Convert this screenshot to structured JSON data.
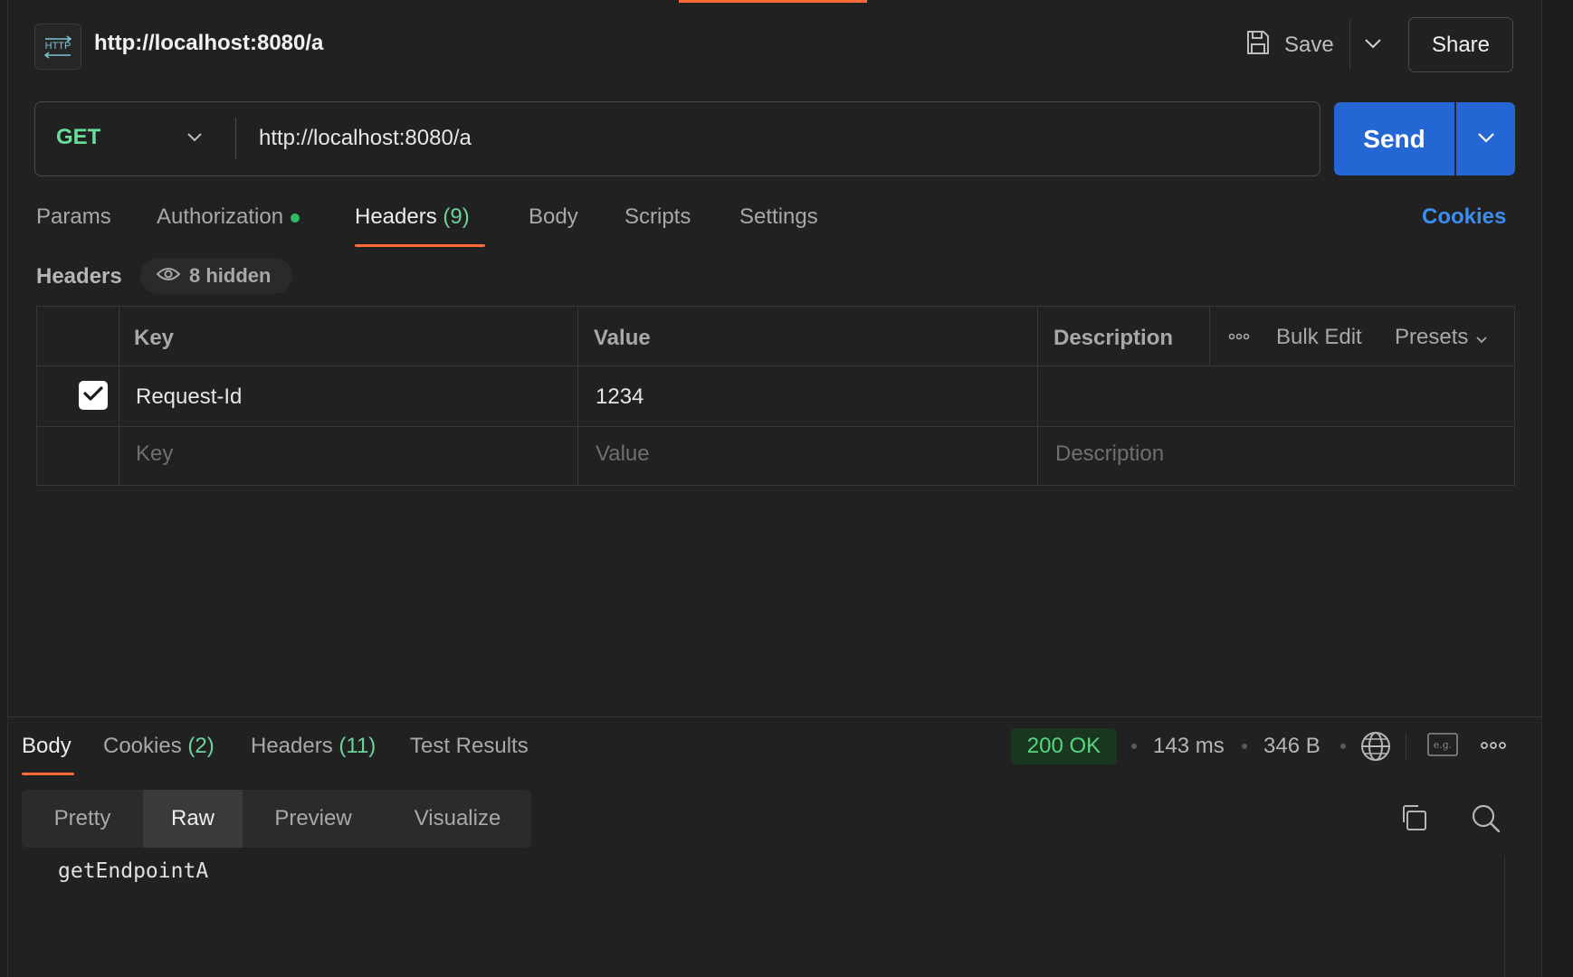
{
  "window": {
    "title": "http://localhost:8080/a"
  },
  "toolbar": {
    "save_label": "Save",
    "share_label": "Share"
  },
  "request": {
    "method": "GET",
    "url": "http://localhost:8080/a",
    "send_label": "Send"
  },
  "request_tabs": {
    "params": "Params",
    "authorization": "Authorization",
    "headers": "Headers",
    "headers_count": "(9)",
    "body": "Body",
    "scripts": "Scripts",
    "settings": "Settings",
    "cookies": "Cookies"
  },
  "headers_section": {
    "label": "Headers",
    "hidden_label": "8 hidden",
    "columns": {
      "key": "Key",
      "value": "Value",
      "description": "Description"
    },
    "tools": {
      "bulk_edit": "Bulk Edit",
      "presets": "Presets"
    },
    "rows": [
      {
        "checked": true,
        "key": "Request-Id",
        "value": "1234",
        "description": ""
      }
    ],
    "placeholders": {
      "key": "Key",
      "value": "Value",
      "description": "Description"
    }
  },
  "response": {
    "tabs": {
      "body": "Body",
      "cookies": "Cookies",
      "cookies_count": "(2)",
      "headers": "Headers",
      "headers_count": "(11)",
      "test_results": "Test Results"
    },
    "status": "200 OK",
    "time": "143 ms",
    "size": "346 B",
    "formats": {
      "pretty": "Pretty",
      "raw": "Raw",
      "preview": "Preview",
      "visualize": "Visualize"
    },
    "active_format": "Raw",
    "body_text": "getEndpointA"
  },
  "colors": {
    "accent": "#ff6c37",
    "send": "#2466d3",
    "method": "#6bdd9a",
    "status_ok": "#57d680",
    "link": "#3a8ef0"
  },
  "icons": [
    "http-icon",
    "save-icon",
    "chevron-down-icon",
    "eye-icon",
    "more-icon",
    "globe-icon",
    "example-icon",
    "copy-icon",
    "search-icon",
    "checkmark-icon"
  ]
}
